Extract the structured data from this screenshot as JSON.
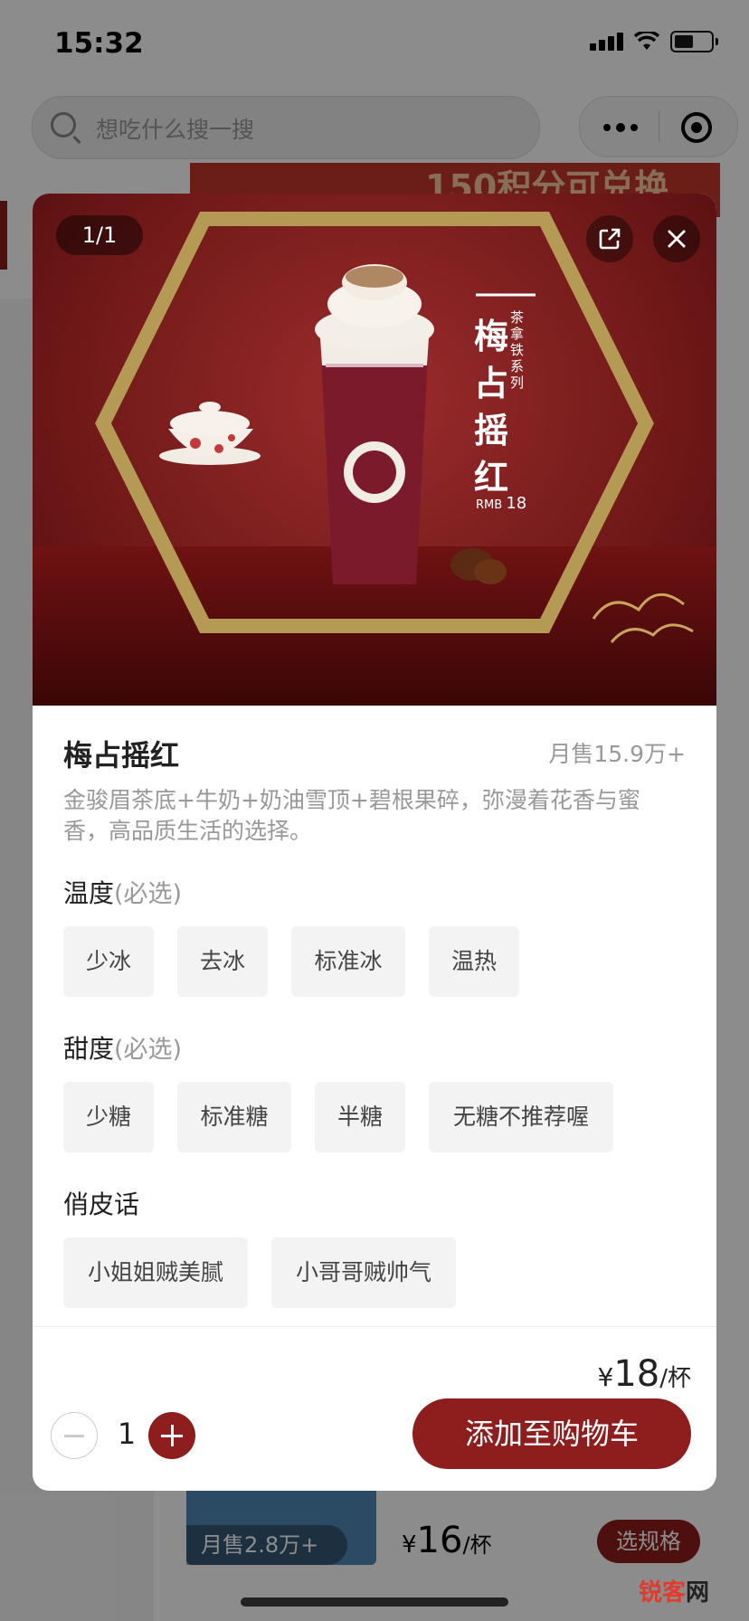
{
  "status_bar": {
    "time": "15:32"
  },
  "search": {
    "placeholder": "想吃什么搜一搜"
  },
  "background": {
    "banner_text": "150积分可兑换",
    "list_item": {
      "sales": "月售2.8万+",
      "price_symbol": "¥",
      "price": "16",
      "unit": "/杯",
      "spec_button": "选规格"
    }
  },
  "product": {
    "image_index": "1/1",
    "image_title": "梅占摇红",
    "image_series": "茶拿铁系列",
    "image_price_label": "RMB",
    "image_price": "18",
    "name": "梅占摇红",
    "monthly_sales": "月售15.9万+",
    "description": "金骏眉茶底+牛奶+奶油雪顶+碧根果碎，弥漫着花香与蜜香，高品质生活的选择。"
  },
  "options": {
    "temperature": {
      "title": "温度",
      "required": "(必选)",
      "items": [
        "少冰",
        "去冰",
        "标准冰",
        "温热"
      ]
    },
    "sweetness": {
      "title": "甜度",
      "required": "(必选)",
      "items": [
        "少糖",
        "标准糖",
        "半糖",
        "无糖不推荐喔"
      ]
    },
    "remark": {
      "title": "俏皮话",
      "items": [
        "小姐姐贼美腻",
        "小哥哥贼帅气"
      ]
    }
  },
  "cart": {
    "price_symbol": "¥",
    "price": "18",
    "unit": "/杯",
    "quantity": "1",
    "add_button": "添加至购物车"
  },
  "watermark": {
    "main": "锐客",
    "suffix": "网"
  },
  "colors": {
    "brand": "#8e1d1d",
    "muted_text": "#999999",
    "option_bg": "#f3f3f3"
  }
}
